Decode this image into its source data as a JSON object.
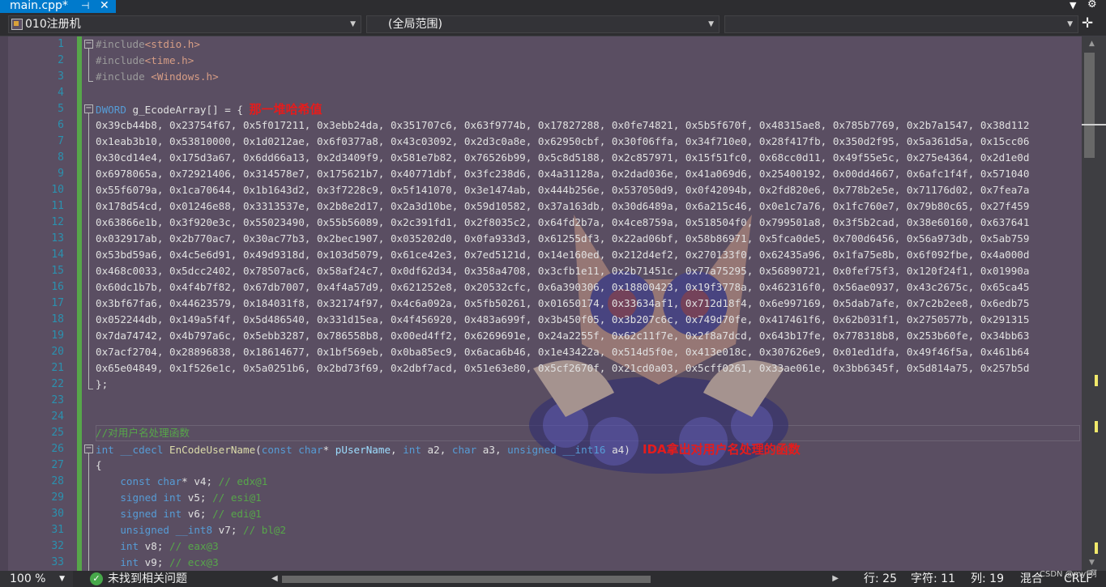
{
  "tab": {
    "title": "main.cpp*",
    "pin": "⊣",
    "close": "✕"
  },
  "nav": {
    "project": "010注册机",
    "scope": "(全局范围)",
    "member": ""
  },
  "line_numbers": [
    "1",
    "2",
    "3",
    "4",
    "5",
    "6",
    "7",
    "8",
    "9",
    "10",
    "11",
    "12",
    "13",
    "14",
    "15",
    "16",
    "17",
    "18",
    "19",
    "20",
    "21",
    "22",
    "23",
    "24",
    "25",
    "26",
    "27",
    "28",
    "29",
    "30",
    "31",
    "32",
    "33"
  ],
  "code": {
    "l1_pp": "#include",
    "l1_str": "<stdio.h>",
    "l2_pp": "#include",
    "l2_str": "<time.h>",
    "l3_pp": "#include",
    "l3_str": " <Windows.h>",
    "l5_type": "DWORD",
    "l5_rest": " g_EcodeArray[] = { ",
    "l5_ann": "那一堆哈希值",
    "hex_rows": [
      "0x39cb44b8, 0x23754f67, 0x5f017211, 0x3ebb24da, 0x351707c6, 0x63f9774b, 0x17827288, 0x0fe74821, 0x5b5f670f, 0x48315ae8, 0x785b7769, 0x2b7a1547, 0x38d112",
      "0x1eab3b10, 0x53810000, 0x1d0212ae, 0x6f0377a8, 0x43c03092, 0x2d3c0a8e, 0x62950cbf, 0x30f06ffa, 0x34f710e0, 0x28f417fb, 0x350d2f95, 0x5a361d5a, 0x15cc06",
      "0x30cd14e4, 0x175d3a67, 0x6dd66a13, 0x2d3409f9, 0x581e7b82, 0x76526b99, 0x5c8d5188, 0x2c857971, 0x15f51fc0, 0x68cc0d11, 0x49f55e5c, 0x275e4364, 0x2d1e0d",
      "0x6978065a, 0x72921406, 0x314578e7, 0x175621b7, 0x40771dbf, 0x3fc238d6, 0x4a31128a, 0x2dad036e, 0x41a069d6, 0x25400192, 0x00dd4667, 0x6afc1f4f, 0x571040",
      "0x55f6079a, 0x1ca70644, 0x1b1643d2, 0x3f7228c9, 0x5f141070, 0x3e1474ab, 0x444b256e, 0x537050d9, 0x0f42094b, 0x2fd820e6, 0x778b2e5e, 0x71176d02, 0x7fea7a",
      "0x178d54cd, 0x01246e88, 0x3313537e, 0x2b8e2d17, 0x2a3d10be, 0x59d10582, 0x37a163db, 0x30d6489a, 0x6a215c46, 0x0e1c7a76, 0x1fc760e7, 0x79b80c65, 0x27f459",
      "0x63866e1b, 0x3f920e3c, 0x55023490, 0x55b56089, 0x2c391fd1, 0x2f8035c2, 0x64fd2b7a, 0x4ce8759a, 0x518504f0, 0x799501a8, 0x3f5b2cad, 0x38e60160, 0x637641",
      "0x032917ab, 0x2b770ac7, 0x30ac77b3, 0x2bec1907, 0x035202d0, 0x0fa933d3, 0x61255df3, 0x22ad06bf, 0x58b86971, 0x5fca0de5, 0x700d6456, 0x56a973db, 0x5ab759",
      "0x53bd59a6, 0x4c5e6d91, 0x49d9318d, 0x103d5079, 0x61ce42e3, 0x7ed5121d, 0x14e160ed, 0x212d4ef2, 0x270133f0, 0x62435a96, 0x1fa75e8b, 0x6f092fbe, 0x4a000d",
      "0x468c0033, 0x5dcc2402, 0x78507ac6, 0x58af24c7, 0x0df62d34, 0x358a4708, 0x3cfb1e11, 0x2b71451c, 0x77a75295, 0x56890721, 0x0fef75f3, 0x120f24f1, 0x01990a",
      "0x60dc1b7b, 0x4f4b7f82, 0x67db7007, 0x4f4a57d9, 0x621252e8, 0x20532cfc, 0x6a390306, 0x18800423, 0x19f3778a, 0x462316f0, 0x56ae0937, 0x43c2675c, 0x65ca45",
      "0x3bf67fa6, 0x44623579, 0x184031f8, 0x32174f97, 0x4c6a092a, 0x5fb50261, 0x01650174, 0x33634af1, 0x712d18f4, 0x6e997169, 0x5dab7afe, 0x7c2b2ee8, 0x6edb75",
      "0x052244db, 0x149a5f4f, 0x5d486540, 0x331d15ea, 0x4f456920, 0x483a699f, 0x3b450f05, 0x3b207c6c, 0x749d70fe, 0x417461f6, 0x62b031f1, 0x2750577b, 0x291315",
      "0x7da74742, 0x4b797a6c, 0x5ebb3287, 0x786558b8, 0x00ed4ff2, 0x6269691e, 0x24a2255f, 0x62c11f7e, 0x2f8a7dcd, 0x643b17fe, 0x778318b8, 0x253b60fe, 0x34bb63",
      "0x7acf2704, 0x28896838, 0x18614677, 0x1bf569eb, 0x0ba85ec9, 0x6aca6b46, 0x1e43422a, 0x514d5f0e, 0x413e018c, 0x307626e9, 0x01ed1dfa, 0x49f46f5a, 0x461b64",
      "0x65e04849, 0x1f526e1c, 0x5a0251b6, 0x2bd73f69, 0x2dbf7acd, 0x51e63e80, 0x5cf2670f, 0x21cd0a03, 0x5cff0261, 0x33ae061e, 0x3bb6345f, 0x5d814a75, 0x257b5d"
    ],
    "l22": "};",
    "l25_comment": "//对用户名处理函数",
    "l26_int": "int",
    "l26_cdecl": " __cdecl ",
    "l26_fn": "EnCodeUserName",
    "l26_p1": "(",
    "l26_const": "const",
    "l26_char1": "char",
    "l26_p2": "* ",
    "l26_pUser": "pUserName",
    "l26_p3": ", ",
    "l26_int2": "int",
    "l26_a2": " a2, ",
    "l26_char2": "char",
    "l26_a3": " a3, ",
    "l26_uns": "unsigned",
    "l26_int16": " __int16",
    "l26_a4": " a4)",
    "l26_ann": "IDA拿出对用户名处理的函数",
    "l27": "{",
    "l28_kw": "const char",
    "l28_rest": "* v4; ",
    "l28_cm": "// edx@1",
    "l29_kw": "signed int",
    "l29_rest": " v5; ",
    "l29_cm": "// esi@1",
    "l30_kw": "signed int",
    "l30_rest": " v6; ",
    "l30_cm": "// edi@1",
    "l31_kw": "unsigned __int8",
    "l31_rest": " v7; ",
    "l31_cm": "// bl@2",
    "l32_kw": "int",
    "l32_rest": " v8; ",
    "l32_cm": "// eax@3",
    "l33_kw": "int",
    "l33_rest": " v9; ",
    "l33_cm": "// ecx@3"
  },
  "status": {
    "zoom": "100 %",
    "issues": "未找到相关问题",
    "row": "行: 25",
    "char": "字符: 11",
    "col": "列: 19",
    "mode": "混合",
    "eol": "CRLF"
  },
  "watermark": "CSDN @myf啊",
  "colors": {
    "accent": "#007acc",
    "editor_bg": "#5a4e62",
    "line_number": "#2b91af",
    "annotation": "#e51c1c"
  }
}
